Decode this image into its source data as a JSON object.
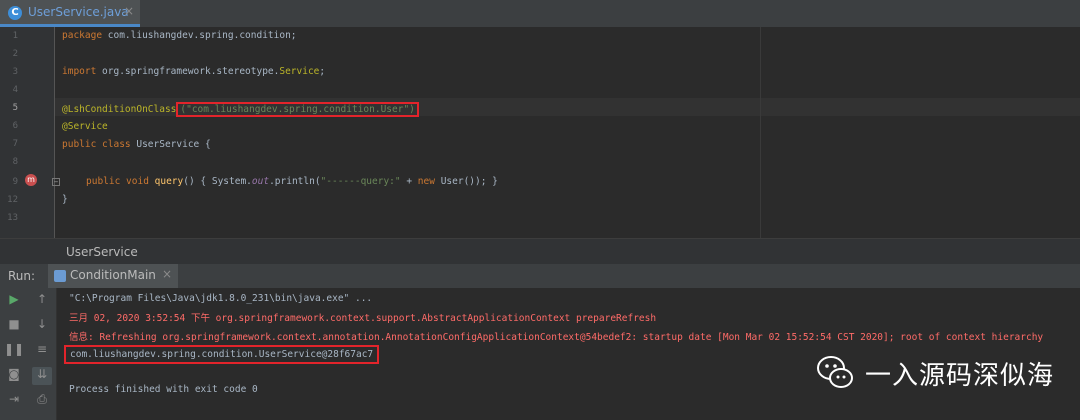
{
  "tab": {
    "icon": "C",
    "label": "UserService.java",
    "close": "×"
  },
  "gutter": {
    "line_numbers": [
      "1",
      "2",
      "3",
      "4",
      "5",
      "6",
      "7",
      "8",
      "9",
      "12",
      "13"
    ]
  },
  "code": {
    "l1_kw": "package",
    "l1_rest": " com.liushangdev.spring.condition;",
    "l3_kw": "import",
    "l3_pkg": " org.springframework.stereotype.",
    "l3_cls": "Service",
    "l3_end": ";",
    "l5_ann": "@LshConditionOnClass",
    "l5_arg": "(\"com.liushangdev.spring.condition.User\")",
    "l6_ann": "@Service",
    "l7_kw": "public class",
    "l7_rest": " UserService {",
    "l9_kw1": "public void",
    "l9_fn": " query",
    "l9_p1": "() { System.",
    "l9_out": "out",
    "l9_p2": ".println(",
    "l9_str": "\"------query:\"",
    "l9_p3": " + ",
    "l9_new": "new",
    "l9_p4": " User()); }",
    "l12": "}"
  },
  "breadcrumb": "UserService",
  "run": {
    "label": "Run:",
    "tab_label": "ConditionMain",
    "tab_close": "×"
  },
  "console_lines": {
    "cmd": "\"C:\\Program Files\\Java\\jdk1.8.0_231\\bin\\java.exe\" ...",
    "log1": "三月 02, 2020 3:52:54 下午 org.springframework.context.support.AbstractApplicationContext prepareRefresh",
    "log2": "信息: Refreshing org.springframework.context.annotation.AnnotationConfigApplicationContext@54bedef2: startup date [Mon Mar 02 15:52:54 CST 2020]; root of context hierarchy",
    "result": "com.liushangdev.spring.condition.UserService@28f67ac7",
    "exit": "Process finished with exit code 0"
  },
  "toolbar_icons": [
    "run-icon",
    "up-icon",
    "stop-icon",
    "down-icon",
    "pause-icon",
    "soft-wrap-icon",
    "camera-icon",
    "scroll-to-end-icon",
    "login-icon",
    "print-icon"
  ],
  "watermark": {
    "text": "一入源码深似海",
    "icon": "wechat-icon"
  },
  "colors": {
    "keyword": "#cc7832",
    "annotation": "#bbb529",
    "string": "#6a8759",
    "error": "#ff6b68",
    "highlight_box": "#e3242b"
  }
}
